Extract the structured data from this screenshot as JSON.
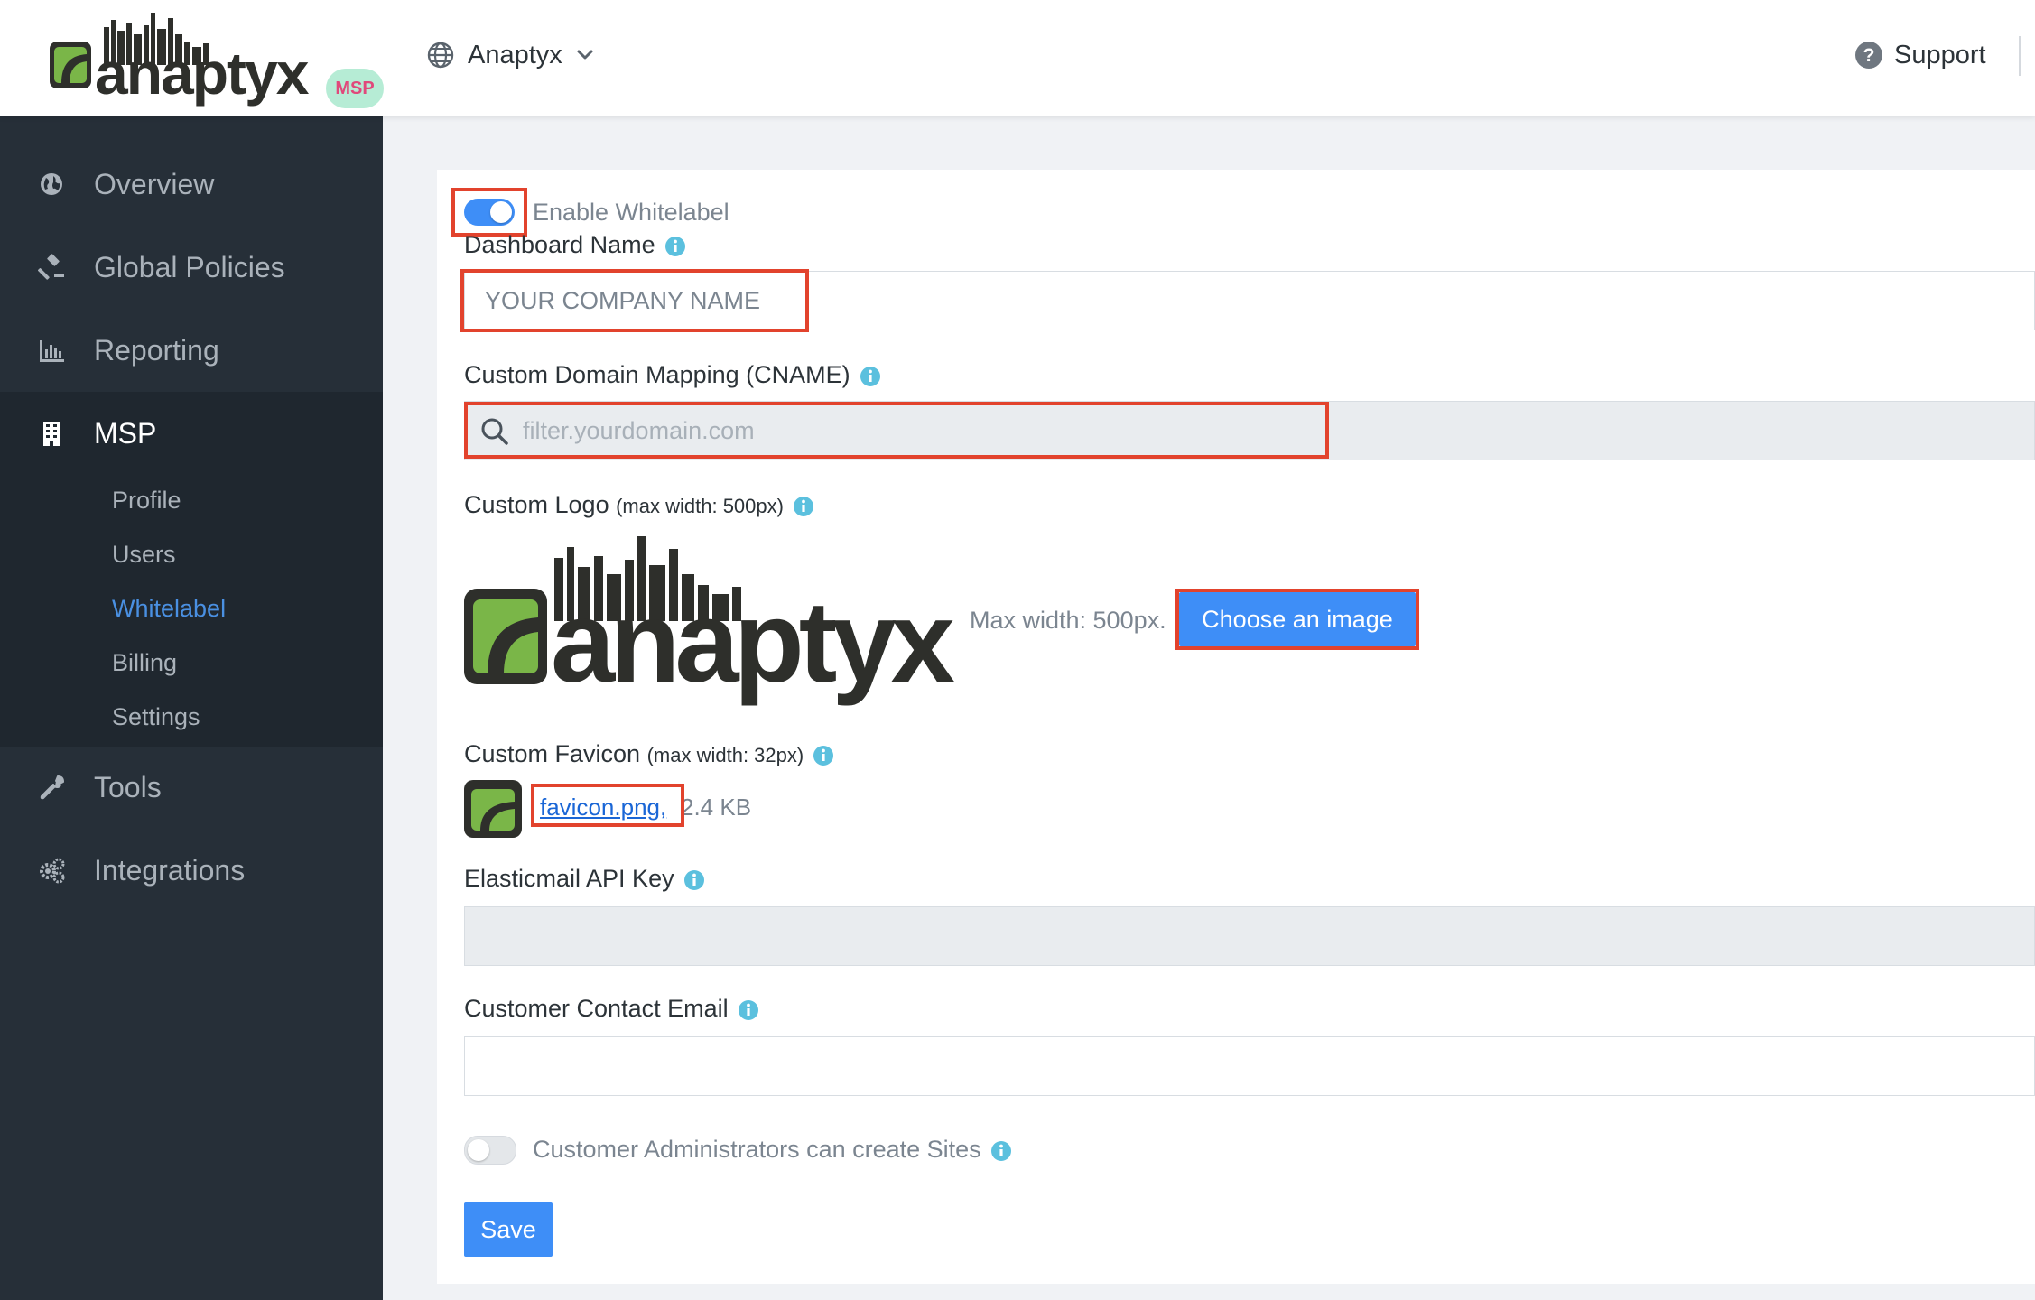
{
  "header": {
    "brand_wordmark": "anaptyx",
    "badge": "MSP",
    "org_name": "Anaptyx",
    "support_label": "Support"
  },
  "sidebar": {
    "items": [
      {
        "label": "Overview",
        "icon": "globe-icon"
      },
      {
        "label": "Global Policies",
        "icon": "gavel-icon"
      },
      {
        "label": "Reporting",
        "icon": "bar-chart-icon"
      },
      {
        "label": "MSP",
        "icon": "building-icon"
      },
      {
        "label": "Tools",
        "icon": "wrench-icon"
      },
      {
        "label": "Integrations",
        "icon": "gears-icon"
      }
    ],
    "msp_subitems": [
      {
        "label": "Profile"
      },
      {
        "label": "Users"
      },
      {
        "label": "Whitelabel"
      },
      {
        "label": "Billing"
      },
      {
        "label": "Settings"
      }
    ],
    "active_item": "MSP",
    "active_subitem": "Whitelabel"
  },
  "form": {
    "enable_whitelabel": {
      "label": "Enable Whitelabel",
      "enabled": true
    },
    "dashboard_name": {
      "label": "Dashboard Name",
      "value": "",
      "placeholder": "YOUR COMPANY NAME"
    },
    "cname": {
      "label": "Custom Domain Mapping (CNAME)",
      "value": "",
      "placeholder": "filter.yourdomain.com"
    },
    "custom_logo": {
      "label": "Custom Logo",
      "hint": "(max width: 500px)",
      "logo_wordmark": "anaptyx",
      "max_width_text": "Max width: 500px.",
      "choose_button": "Choose an image"
    },
    "custom_favicon": {
      "label": "Custom Favicon",
      "hint": "(max width: 32px)",
      "file_name": "favicon.png,",
      "file_size": "2.4 KB"
    },
    "elasticmail_api_key": {
      "label": "Elasticmail API Key",
      "value": ""
    },
    "customer_contact_email": {
      "label": "Customer Contact Email",
      "value": ""
    },
    "customer_admins_create_sites": {
      "label": "Customer Administrators can create Sites",
      "enabled": false
    },
    "save_button": "Save"
  },
  "colors": {
    "accent": "#3e8ef7",
    "sidebar_bg": "#262f38",
    "sidebar_active_link": "#4a90e2",
    "brand_green": "#7ab648",
    "brand_dark": "#2e2f2b",
    "highlight_red": "#e2432d",
    "info_teal": "#5bc0de",
    "badge_bg": "#b6ecd5",
    "badge_text": "#e0497b"
  }
}
